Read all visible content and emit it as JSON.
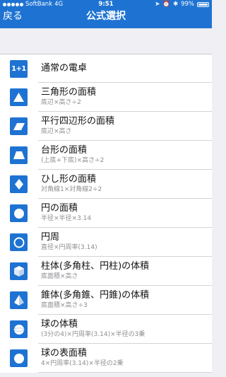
{
  "status_bar": {
    "carrier": "SoftBank",
    "network": "4G",
    "time": "9:51",
    "battery": "99%"
  },
  "navbar": {
    "back_label": "戻る",
    "title": "公式選択"
  },
  "rows": [
    {
      "name": "通常の電卓",
      "formula": "",
      "icon": "calculator-icon",
      "icon_text": "1+1"
    },
    {
      "name": "三角形の面積",
      "formula": "底辺×高さ÷2",
      "icon": "triangle-icon"
    },
    {
      "name": "平行四辺形の面積",
      "formula": "底辺×高さ",
      "icon": "parallelogram-icon"
    },
    {
      "name": "台形の面積",
      "formula": "(上底+下底)×高さ÷2",
      "icon": "trapezoid-icon"
    },
    {
      "name": "ひし形の面積",
      "formula": "対角線1×対角線2÷2",
      "icon": "rhombus-icon"
    },
    {
      "name": "円の面積",
      "formula": "半径×半径×3.14",
      "icon": "circle-icon"
    },
    {
      "name": "円周",
      "formula": "直径×円周率(3.14)",
      "icon": "circle-outline-icon"
    },
    {
      "name": "柱体(多角柱、円柱)の体積",
      "formula": "底面積×高さ",
      "icon": "cube-icon"
    },
    {
      "name": "錐体(多角錐、円錐)の体積",
      "formula": "底面積×高さ÷3",
      "icon": "cone-icon"
    },
    {
      "name": "球の体積",
      "formula": "(3分の4)×円周率(3.14)×半径の3乗",
      "icon": "sphere-icon"
    },
    {
      "name": "球の表面積",
      "formula": "4×円周率(3.14)×半径の2乗",
      "icon": "sphere-surface-icon"
    }
  ],
  "colors": {
    "accent": "#1e73d2",
    "background": "#efeff4",
    "secondary_text": "#8e8e93"
  }
}
